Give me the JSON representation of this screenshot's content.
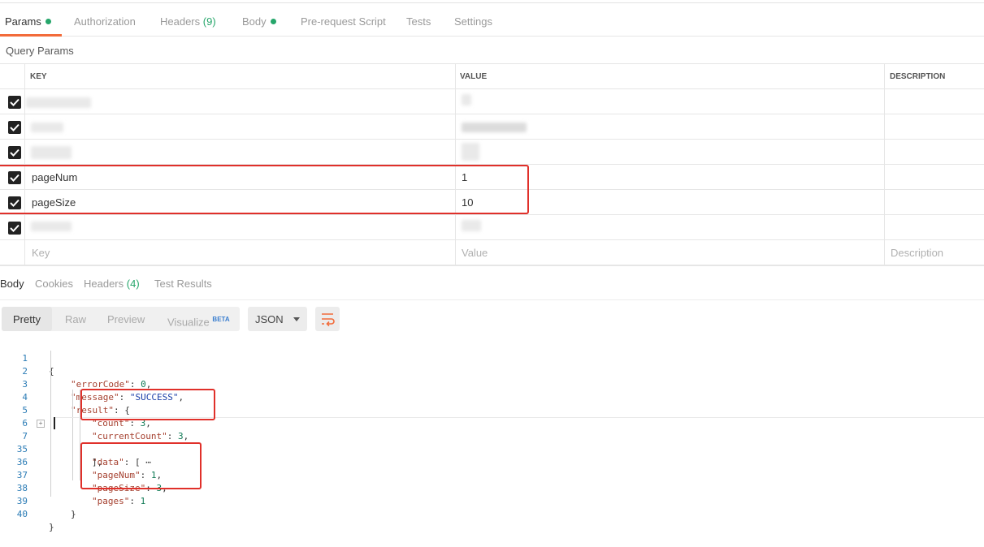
{
  "request_tabs": [
    {
      "label": "Params",
      "dot": true
    },
    {
      "label": "Authorization"
    },
    {
      "label": "Headers",
      "count": "(9)"
    },
    {
      "label": "Body",
      "dot": true
    },
    {
      "label": "Pre-request Script"
    },
    {
      "label": "Tests"
    },
    {
      "label": "Settings"
    }
  ],
  "query_params": {
    "section_label": "Query Params",
    "columns": {
      "key": "KEY",
      "value": "VALUE",
      "description": "DESCRIPTION"
    },
    "rows": [
      {
        "key": "",
        "value": "",
        "checked": true,
        "redacted": true
      },
      {
        "key": "",
        "value": "",
        "checked": true,
        "redacted": true
      },
      {
        "key": "",
        "value": "",
        "checked": true,
        "redacted": true
      },
      {
        "key": "pageNum",
        "value": "1",
        "checked": true
      },
      {
        "key": "pageSize",
        "value": "10",
        "checked": true
      },
      {
        "key": "",
        "value": "",
        "checked": true,
        "redacted": true
      }
    ],
    "placeholders": {
      "key": "Key",
      "value": "Value",
      "description": "Description"
    }
  },
  "response_tabs": [
    {
      "label": "Body"
    },
    {
      "label": "Cookies"
    },
    {
      "label": "Headers",
      "count": "(4)"
    },
    {
      "label": "Test Results"
    }
  ],
  "view_modes": {
    "pretty": "Pretty",
    "raw": "Raw",
    "preview": "Preview",
    "visualize": "Visualize",
    "beta": "BETA"
  },
  "format_select": "JSON",
  "code_lines": [
    {
      "n": "1",
      "text": "{"
    },
    {
      "n": "2",
      "text": "\"errorCode\": 0,"
    },
    {
      "n": "3",
      "text": "\"message\": \"SUCCESS\","
    },
    {
      "n": "4",
      "text": "\"result\": {"
    },
    {
      "n": "5",
      "text": "\"count\": 3,"
    },
    {
      "n": "6",
      "text": "\"currentCount\": 3,"
    },
    {
      "n": "7",
      "text": "\"data\": [ ⋯"
    },
    {
      "n": "35",
      "text": "],"
    },
    {
      "n": "36",
      "text": "\"pageNum\": 1,"
    },
    {
      "n": "37",
      "text": "\"pageSize\": 3,"
    },
    {
      "n": "38",
      "text": "\"pages\": 1"
    },
    {
      "n": "39",
      "text": "}"
    },
    {
      "n": "40",
      "text": "}"
    }
  ],
  "colors": {
    "accent": "#f26b3a",
    "success": "#26a66b",
    "highlight": "#e0302a"
  }
}
